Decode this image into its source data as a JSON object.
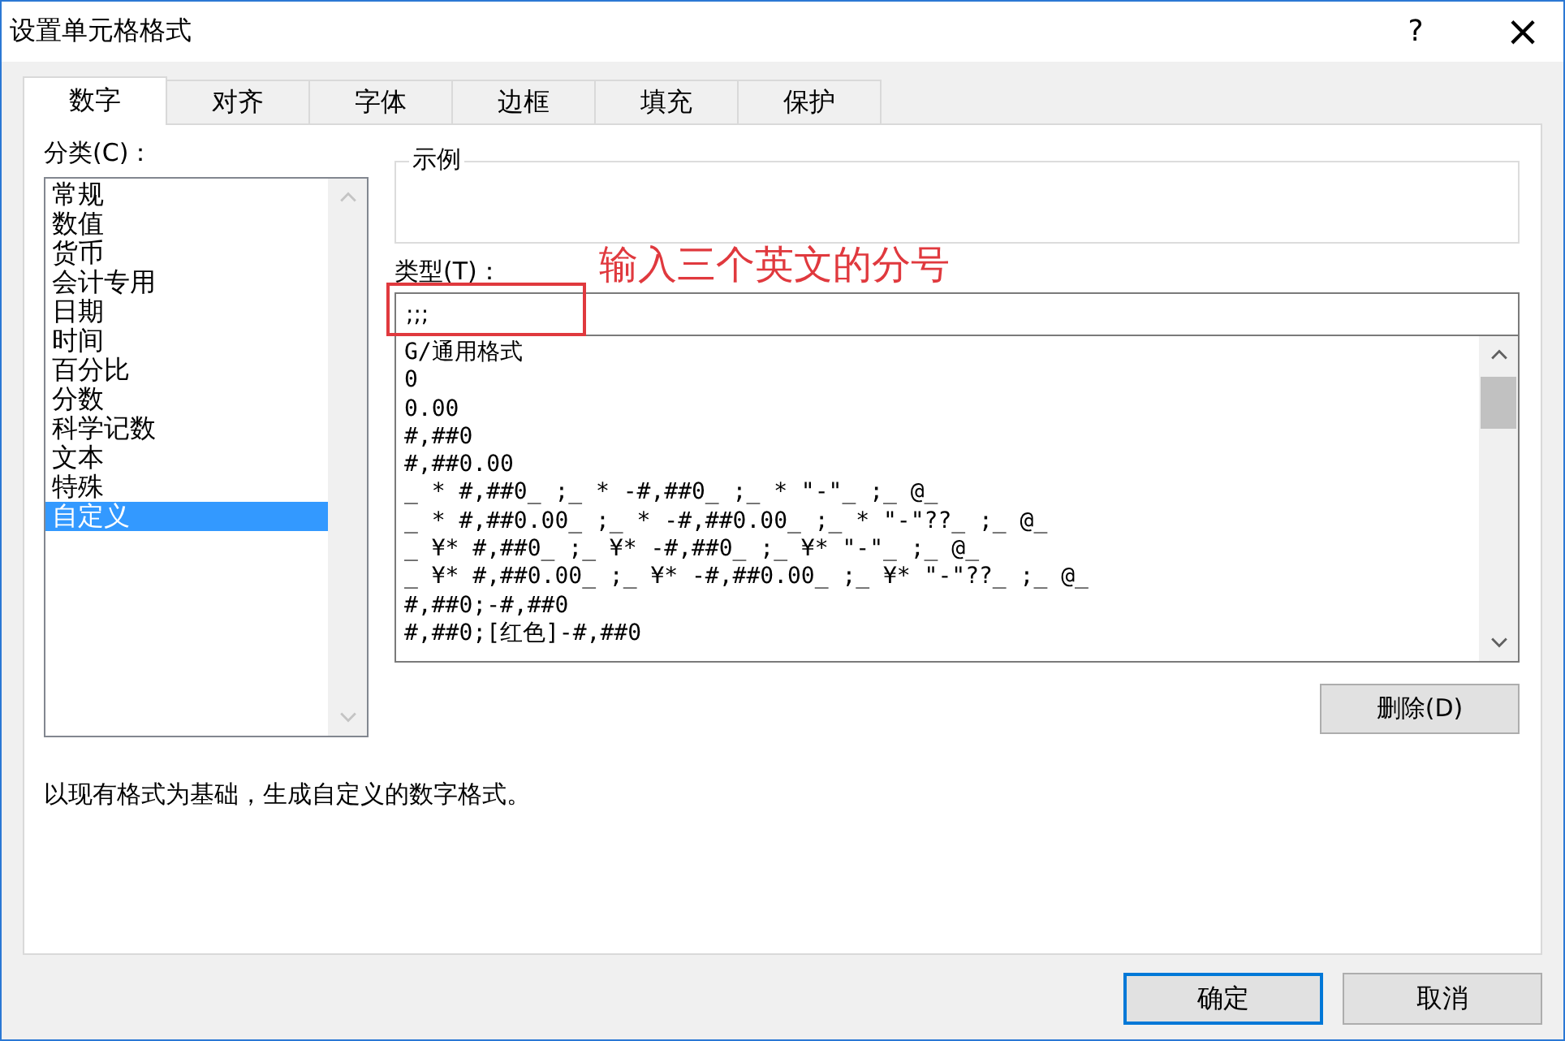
{
  "window": {
    "title": "设置单元格格式",
    "help": "?",
    "close": "×"
  },
  "tabs": [
    {
      "label": "数字",
      "selected": true
    },
    {
      "label": "对齐",
      "selected": false
    },
    {
      "label": "字体",
      "selected": false
    },
    {
      "label": "边框",
      "selected": false
    },
    {
      "label": "填充",
      "selected": false
    },
    {
      "label": "保护",
      "selected": false
    }
  ],
  "category": {
    "label": "分类(C)：",
    "items": [
      {
        "label": "常规",
        "selected": false
      },
      {
        "label": "数值",
        "selected": false
      },
      {
        "label": "货币",
        "selected": false
      },
      {
        "label": "会计专用",
        "selected": false
      },
      {
        "label": "日期",
        "selected": false
      },
      {
        "label": "时间",
        "selected": false
      },
      {
        "label": "百分比",
        "selected": false
      },
      {
        "label": "分数",
        "selected": false
      },
      {
        "label": "科学记数",
        "selected": false
      },
      {
        "label": "文本",
        "selected": false
      },
      {
        "label": "特殊",
        "selected": false
      },
      {
        "label": "自定义",
        "selected": true
      }
    ]
  },
  "sample": {
    "label": "示例"
  },
  "type": {
    "label": "类型(T)：",
    "value": ";;;"
  },
  "annotation": "输入三个英文的分号",
  "formats": [
    "G/通用格式",
    "0",
    "0.00",
    "#,##0",
    "#,##0.00",
    "_ * #,##0_ ;_ * -#,##0_ ;_ * \"-\"_ ;_ @_",
    "_ * #,##0.00_ ;_ * -#,##0.00_ ;_ * \"-\"??_ ;_ @_",
    "_ ¥* #,##0_ ;_ ¥* -#,##0_ ;_ ¥* \"-\"_ ;_ @_",
    "_ ¥* #,##0.00_ ;_ ¥* -#,##0.00_ ;_ ¥* \"-\"??_ ;_ @_",
    "#,##0;-#,##0",
    "#,##0;[红色]-#,##0"
  ],
  "delete_button": "删除(D)",
  "description": "以现有格式为基础，生成自定义的数字格式。",
  "buttons": [
    {
      "label": "确定",
      "kind": "default"
    },
    {
      "label": "取消",
      "kind": "normal"
    }
  ]
}
